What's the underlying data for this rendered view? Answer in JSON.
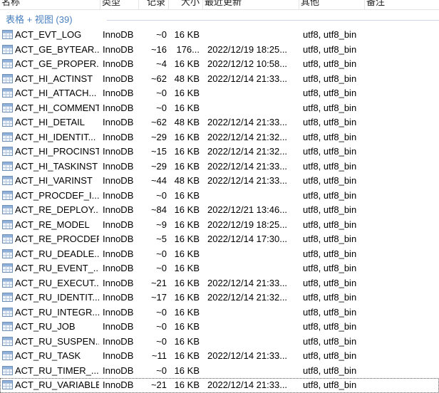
{
  "columns": {
    "name": "名称",
    "type": "类型",
    "rows": "记录",
    "size": "大小",
    "updated": "最近更新",
    "other": "其他",
    "note": "备注"
  },
  "group": {
    "label": "表格 + 视图 (39)"
  },
  "icon": "table-icon",
  "rows": [
    {
      "name": "ACT_EVT_LOG",
      "type": "InnoDB",
      "rows": "~0",
      "size": "16 KB",
      "updated": "",
      "other": "utf8, utf8_bin"
    },
    {
      "name": "ACT_GE_BYTEAR...",
      "type": "InnoDB",
      "rows": "~16",
      "size": "176...",
      "updated": "2022/12/19 18:25...",
      "other": "utf8, utf8_bin"
    },
    {
      "name": "ACT_GE_PROPER...",
      "type": "InnoDB",
      "rows": "~4",
      "size": "16 KB",
      "updated": "2022/12/12 10:58...",
      "other": "utf8, utf8_bin"
    },
    {
      "name": "ACT_HI_ACTINST",
      "type": "InnoDB",
      "rows": "~62",
      "size": "48 KB",
      "updated": "2022/12/14 21:33...",
      "other": "utf8, utf8_bin"
    },
    {
      "name": "ACT_HI_ATTACH...",
      "type": "InnoDB",
      "rows": "~0",
      "size": "16 KB",
      "updated": "",
      "other": "utf8, utf8_bin"
    },
    {
      "name": "ACT_HI_COMMENT",
      "type": "InnoDB",
      "rows": "~0",
      "size": "16 KB",
      "updated": "",
      "other": "utf8, utf8_bin"
    },
    {
      "name": "ACT_HI_DETAIL",
      "type": "InnoDB",
      "rows": "~62",
      "size": "48 KB",
      "updated": "2022/12/14 21:33...",
      "other": "utf8, utf8_bin"
    },
    {
      "name": "ACT_HI_IDENTIT...",
      "type": "InnoDB",
      "rows": "~29",
      "size": "16 KB",
      "updated": "2022/12/14 21:32...",
      "other": "utf8, utf8_bin"
    },
    {
      "name": "ACT_HI_PROCINST",
      "type": "InnoDB",
      "rows": "~15",
      "size": "16 KB",
      "updated": "2022/12/14 21:32...",
      "other": "utf8, utf8_bin"
    },
    {
      "name": "ACT_HI_TASKINST",
      "type": "InnoDB",
      "rows": "~29",
      "size": "16 KB",
      "updated": "2022/12/14 21:33...",
      "other": "utf8, utf8_bin"
    },
    {
      "name": "ACT_HI_VARINST",
      "type": "InnoDB",
      "rows": "~44",
      "size": "48 KB",
      "updated": "2022/12/14 21:33...",
      "other": "utf8, utf8_bin"
    },
    {
      "name": "ACT_PROCDEF_I...",
      "type": "InnoDB",
      "rows": "~0",
      "size": "16 KB",
      "updated": "",
      "other": "utf8, utf8_bin"
    },
    {
      "name": "ACT_RE_DEPLOY...",
      "type": "InnoDB",
      "rows": "~84",
      "size": "16 KB",
      "updated": "2022/12/21 13:46...",
      "other": "utf8, utf8_bin"
    },
    {
      "name": "ACT_RE_MODEL",
      "type": "InnoDB",
      "rows": "~9",
      "size": "16 KB",
      "updated": "2022/12/19 18:25...",
      "other": "utf8, utf8_bin"
    },
    {
      "name": "ACT_RE_PROCDEF",
      "type": "InnoDB",
      "rows": "~5",
      "size": "16 KB",
      "updated": "2022/12/14 17:30...",
      "other": "utf8, utf8_bin"
    },
    {
      "name": "ACT_RU_DEADLE...",
      "type": "InnoDB",
      "rows": "~0",
      "size": "16 KB",
      "updated": "",
      "other": "utf8, utf8_bin"
    },
    {
      "name": "ACT_RU_EVENT_...",
      "type": "InnoDB",
      "rows": "~0",
      "size": "16 KB",
      "updated": "",
      "other": "utf8, utf8_bin"
    },
    {
      "name": "ACT_RU_EXECUT...",
      "type": "InnoDB",
      "rows": "~21",
      "size": "16 KB",
      "updated": "2022/12/14 21:33...",
      "other": "utf8, utf8_bin"
    },
    {
      "name": "ACT_RU_IDENTIT...",
      "type": "InnoDB",
      "rows": "~17",
      "size": "16 KB",
      "updated": "2022/12/14 21:32...",
      "other": "utf8, utf8_bin"
    },
    {
      "name": "ACT_RU_INTEGR...",
      "type": "InnoDB",
      "rows": "~0",
      "size": "16 KB",
      "updated": "",
      "other": "utf8, utf8_bin"
    },
    {
      "name": "ACT_RU_JOB",
      "type": "InnoDB",
      "rows": "~0",
      "size": "16 KB",
      "updated": "",
      "other": "utf8, utf8_bin"
    },
    {
      "name": "ACT_RU_SUSPEN...",
      "type": "InnoDB",
      "rows": "~0",
      "size": "16 KB",
      "updated": "",
      "other": "utf8, utf8_bin"
    },
    {
      "name": "ACT_RU_TASK",
      "type": "InnoDB",
      "rows": "~11",
      "size": "16 KB",
      "updated": "2022/12/14 21:33...",
      "other": "utf8, utf8_bin"
    },
    {
      "name": "ACT_RU_TIMER_...",
      "type": "InnoDB",
      "rows": "~0",
      "size": "16 KB",
      "updated": "",
      "other": "utf8, utf8_bin"
    },
    {
      "name": "ACT_RU_VARIABLE",
      "type": "InnoDB",
      "rows": "~21",
      "size": "16 KB",
      "updated": "2022/12/14 21:33...",
      "other": "utf8, utf8_bin",
      "selected": true
    }
  ]
}
